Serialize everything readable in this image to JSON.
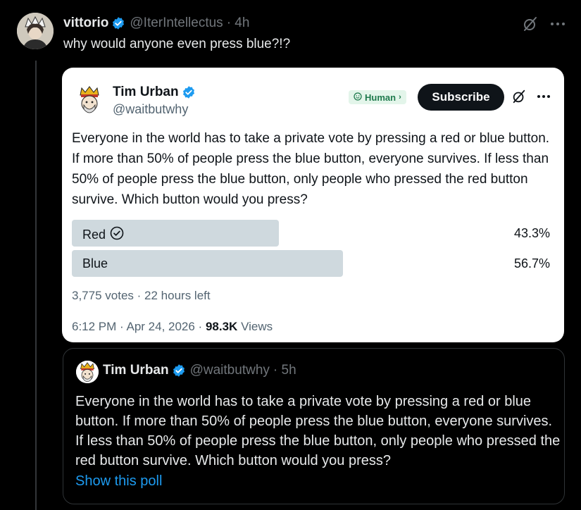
{
  "tweet": {
    "author_name": "vittorio",
    "author_handle": "@IterIntellectus",
    "time": "· 4h",
    "text": "why would anyone even press blue?!?"
  },
  "quoted_card": {
    "author_name": "Tim Urban",
    "author_handle": "@waitbutwhy",
    "badge_label": "Human",
    "subscribe_label": "Subscribe",
    "poll": {
      "question": "Everyone in the world has to take a private vote by pressing a red or blue button. If more than 50% of people press the blue button, everyone survives. If less than 50% of people press the blue button, only people who pressed the red button survive. Which button would you press?",
      "options": [
        {
          "label": "Red",
          "percent_text": "43.3%",
          "percent": 43.3,
          "selected": true
        },
        {
          "label": "Blue",
          "percent_text": "56.7%",
          "percent": 56.7,
          "selected": false
        }
      ],
      "votes": "3,775 votes",
      "time_left": "22 hours left"
    },
    "timestamp": "6:12 PM · Apr 24, 2026 ·",
    "views_count": "98.3K",
    "views_label": "Views"
  },
  "quote_tweet": {
    "author_name": "Tim Urban",
    "author_handle": "@waitbutwhy",
    "time": "· 5h",
    "text": "Everyone in the world has to take a private vote by pressing a red or blue button. If more than 50% of people press the blue button, everyone survives. If less than 50% of people press the blue button, only people who pressed the red button survive. Which button would you press?",
    "show_poll_label": "Show this poll"
  },
  "colors": {
    "background": "#000000",
    "accent": "#1d9bf0",
    "poll_bar": "#cfd9de",
    "verified": "#1d9bf0"
  },
  "icons": [
    "grok-slash-icon",
    "more-icon",
    "verified-icon",
    "check-circle-icon",
    "human-badge-icon",
    "chevron-right-icon"
  ]
}
